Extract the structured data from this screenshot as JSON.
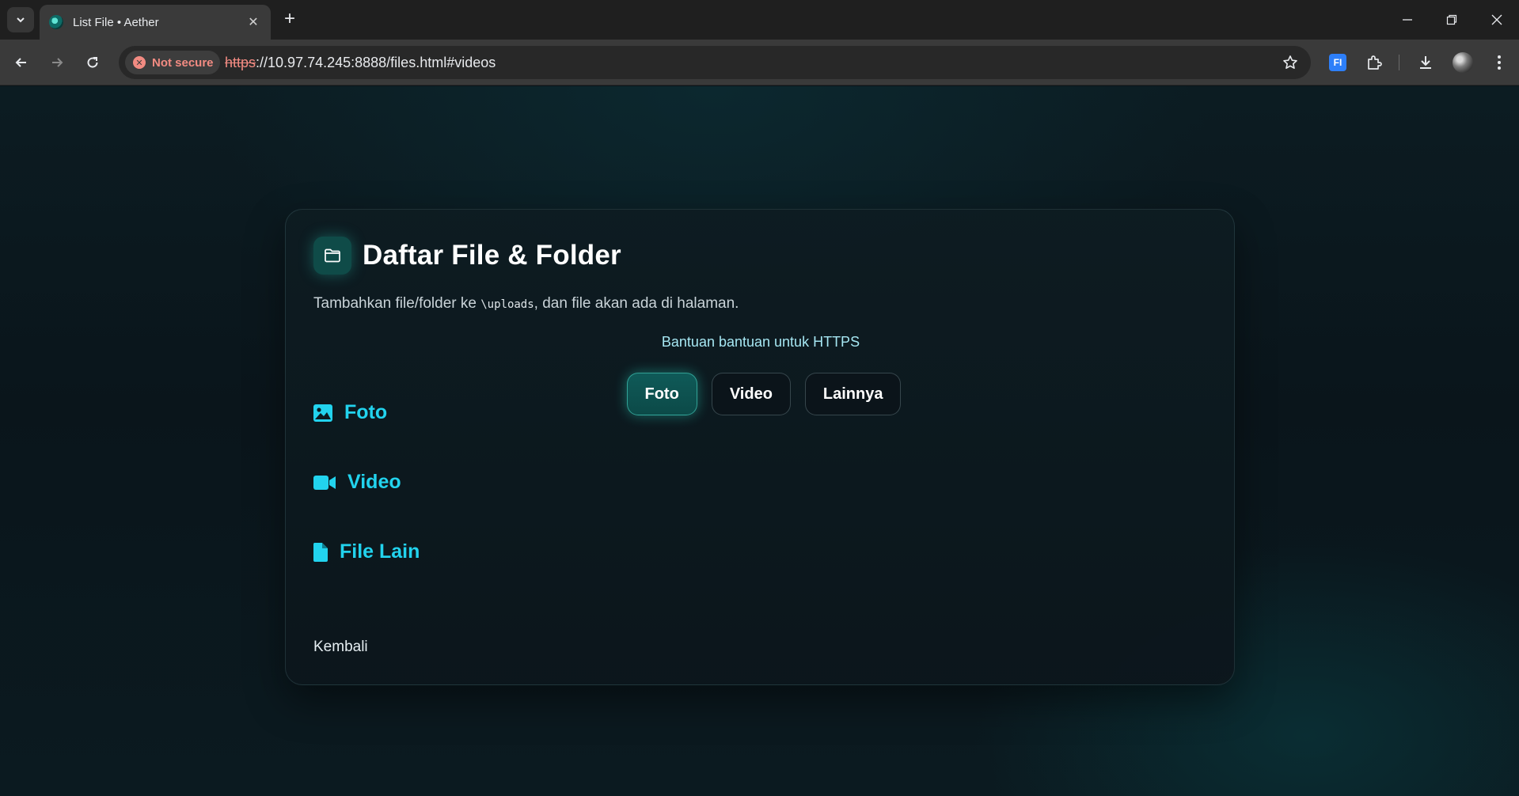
{
  "browser": {
    "tab_title": "List File • Aether",
    "tab_close": "✕",
    "new_tab": "+",
    "security_label": "Not secure",
    "url_scheme": "https",
    "url_rest": "://10.97.74.245:8888/files.html#videos",
    "extension_label": "FI"
  },
  "page": {
    "title": "Daftar File & Folder",
    "description_before": "Tambahkan file/folder ke ",
    "description_code": "\\uploads",
    "description_after": ", dan file akan ada di halaman.",
    "help_link": "Bantuan bantuan untuk HTTPS",
    "filters": [
      {
        "label": "Foto",
        "active": true
      },
      {
        "label": "Video",
        "active": false
      },
      {
        "label": "Lainnya",
        "active": false
      }
    ],
    "sections": [
      {
        "label": "Foto",
        "icon": "image-icon"
      },
      {
        "label": "Video",
        "icon": "video-camera-icon"
      },
      {
        "label": "File Lain",
        "icon": "file-icon"
      }
    ],
    "back_link": "Kembali"
  },
  "colors": {
    "accent": "#22d3ee",
    "active_filter": "#0f5a58",
    "background": "#0b1419"
  }
}
